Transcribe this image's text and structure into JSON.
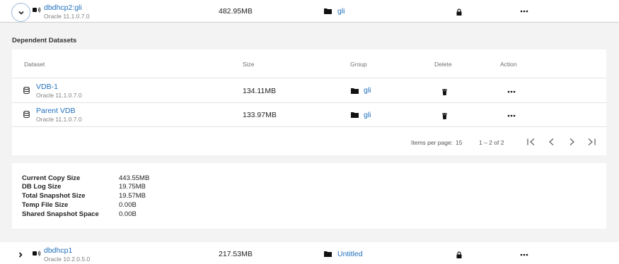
{
  "top_row": {
    "name": "dbdhcp2:gli",
    "subtitle": "Oracle 11.1.0.7.0",
    "size": "482.95MB",
    "group": "gli"
  },
  "dependent": {
    "title": "Dependent Datasets",
    "headers": [
      "Dataset",
      "Size",
      "Group",
      "Delete",
      "Action"
    ],
    "rows": [
      {
        "name": "VDB-1",
        "subtitle": "Oracle 11.1.0.7.0",
        "size": "134.11MB",
        "group": "gli"
      },
      {
        "name": "Parent VDB",
        "subtitle": "Oracle 11.1.0.7.0",
        "size": "133.97MB",
        "group": "gli"
      }
    ],
    "pagination": {
      "items_per_page_label": "Items per page:",
      "items_per_page": "15",
      "range": "1 – 2 of 2"
    }
  },
  "stats": {
    "labels": [
      "Current Copy Size",
      "DB Log Size",
      "Total Snapshot Size",
      "Temp File Size",
      "Shared Snapshot Space"
    ],
    "values": [
      "443.55MB",
      "19.75MB",
      "19.57MB",
      "0.00B",
      "0.00B"
    ]
  },
  "bottom_row": {
    "name": "dbdhcp1",
    "subtitle": "Oracle 10.2.0.5.0",
    "size": "217.53MB",
    "group": "Untitled"
  },
  "icons": {
    "toggle": "chevron-down-icon",
    "expand": "chevron-right-icon",
    "source": "database-source-icon",
    "dataset": "database-icon",
    "folder": "folder-icon",
    "lock": "lock-icon",
    "trash": "trash-icon",
    "action": "more-icon"
  },
  "colors": {
    "link": "#1f6fbd",
    "background": "#f3f3f3",
    "toggle_border": "#9fb9d8"
  }
}
